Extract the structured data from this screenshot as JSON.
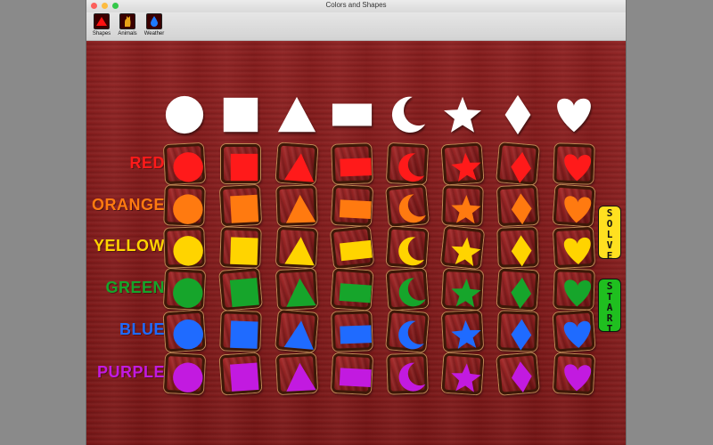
{
  "window": {
    "title": "Colors and Shapes"
  },
  "toolbar": {
    "items": [
      {
        "label": "Shapes",
        "icon": "shapes-icon"
      },
      {
        "label": "Animals",
        "icon": "animal-icon"
      },
      {
        "label": "Weather",
        "icon": "raindrop-icon"
      }
    ]
  },
  "shapes": [
    "circle",
    "square",
    "triangle",
    "rectangle",
    "crescent",
    "star",
    "diamond",
    "heart"
  ],
  "rows": [
    {
      "label": "RED",
      "color": "#ff1a1a"
    },
    {
      "label": "ORANGE",
      "color": "#ff7a10"
    },
    {
      "label": "YELLOW",
      "color": "#ffd400"
    },
    {
      "label": "GREEN",
      "color": "#16a52b"
    },
    {
      "label": "BLUE",
      "color": "#1f6bff"
    },
    {
      "label": "PURPLE",
      "color": "#c21ae0"
    }
  ],
  "buttons": {
    "solve": {
      "label": "SOLVE",
      "color": "#ffe020"
    },
    "start": {
      "label": "START",
      "color": "#1fbf1f"
    }
  },
  "colors": {
    "board": "#8a1c1c",
    "header_shapes": "#ffffff"
  }
}
